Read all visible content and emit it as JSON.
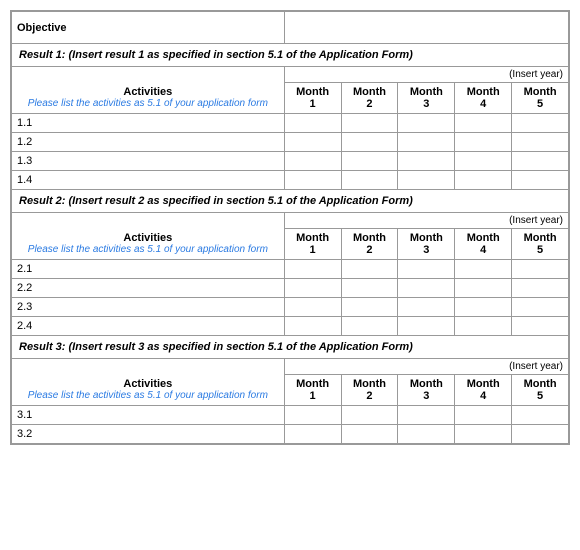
{
  "table": {
    "objective_label": "Objective",
    "results": [
      {
        "result_label": "Result 1: (Insert result 1 as  specified in section 5.1 of the Application Form)",
        "insert_year": "(Insert year)",
        "activities_header": "Activities",
        "activities_subtext": "Please list the activities as 5.1 of your application form",
        "months": [
          {
            "label": "Month",
            "num": "1"
          },
          {
            "label": "Month",
            "num": "2"
          },
          {
            "label": "Month",
            "num": "3"
          },
          {
            "label": "Month",
            "num": "4"
          },
          {
            "label": "Month",
            "num": "5"
          }
        ],
        "rows": [
          "1.1",
          "1.2",
          "1.3",
          "1.4"
        ]
      },
      {
        "result_label": "Result 2: (Insert result 2 as specified in section 5.1 of the Application Form)",
        "insert_year": "(Insert year)",
        "activities_header": "Activities",
        "activities_subtext": "Please list the activities as 5.1 of your application form",
        "months": [
          {
            "label": "Month",
            "num": "1"
          },
          {
            "label": "Month",
            "num": "2"
          },
          {
            "label": "Month",
            "num": "3"
          },
          {
            "label": "Month",
            "num": "4"
          },
          {
            "label": "Month",
            "num": "5"
          }
        ],
        "rows": [
          "2.1",
          "2.2",
          "2.3",
          "2.4"
        ]
      },
      {
        "result_label": "Result 3: (Insert result 3 as specified in section 5.1 of the Application Form)",
        "insert_year": "(Insert year)",
        "activities_header": "Activities",
        "activities_subtext": "Please list the activities as 5.1 of your application form",
        "months": [
          {
            "label": "Month",
            "num": "1"
          },
          {
            "label": "Month",
            "num": "2"
          },
          {
            "label": "Month",
            "num": "3"
          },
          {
            "label": "Month",
            "num": "4"
          },
          {
            "label": "Month",
            "num": "5"
          }
        ],
        "rows": [
          "3.1",
          "3.2"
        ]
      }
    ]
  }
}
